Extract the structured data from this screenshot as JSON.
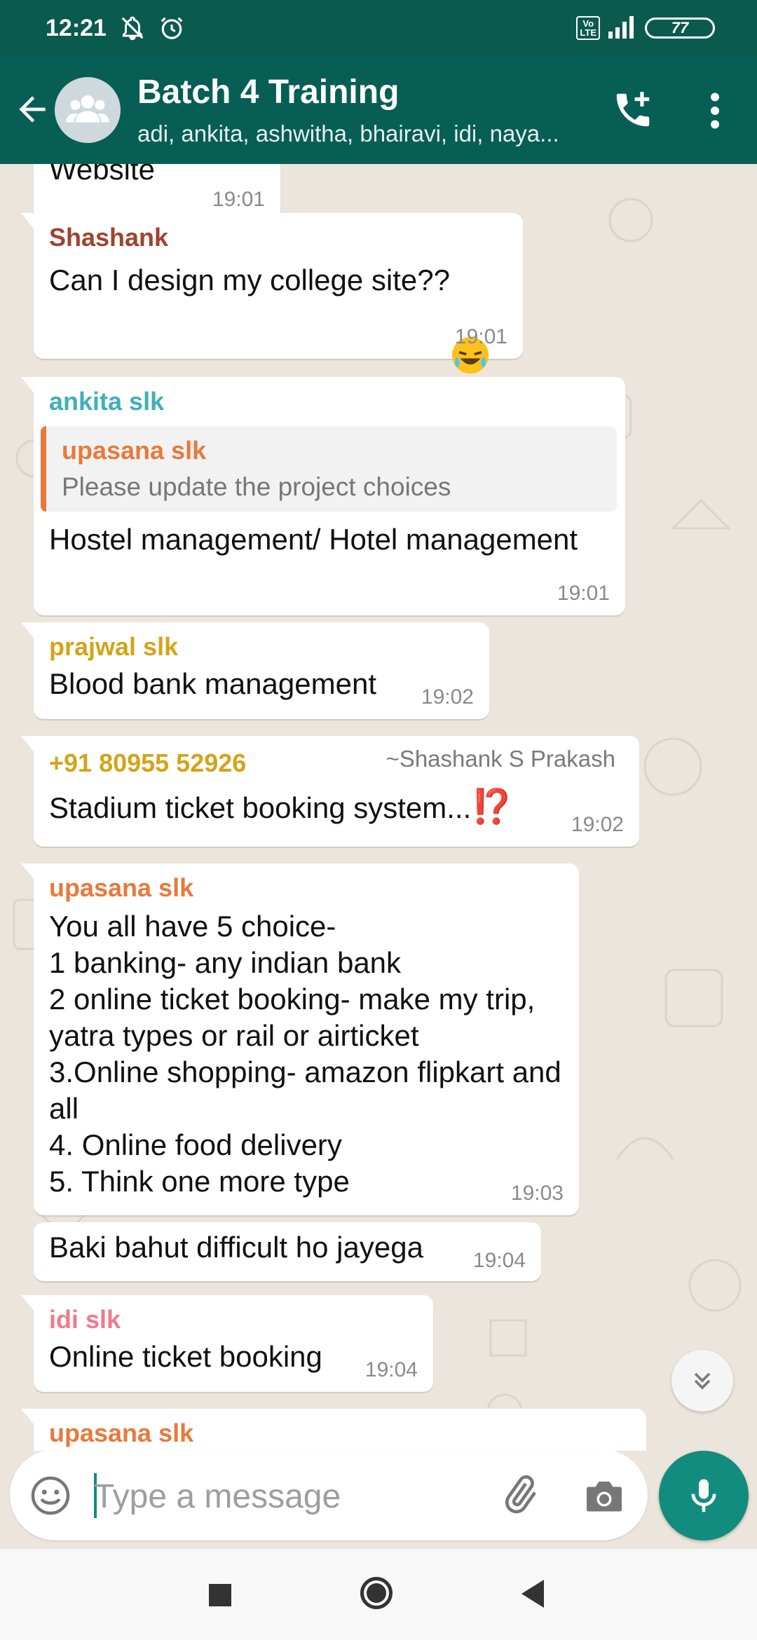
{
  "status_bar": {
    "time": "12:21",
    "volte": "Vo\nLTE",
    "battery": "77",
    "icons": [
      "mute-notifications-icon",
      "alarm-icon",
      "volte-icon",
      "signal-icon",
      "battery-icon"
    ]
  },
  "header": {
    "title": "Batch 4 Training",
    "subtitle": "adi, ankita, ashwitha, bhairavi, idi, naya...",
    "icons": [
      "back-arrow-icon",
      "group-avatar-icon",
      "add-call-icon",
      "more-options-icon"
    ]
  },
  "messages": [
    {
      "sender": "",
      "text": "Website",
      "time": "19:01"
    },
    {
      "sender": "Shashank",
      "sender_color": "#a0432f",
      "text": "Can I design my college site??",
      "emoji": "rolling-on-floor-laughing",
      "time": "19:01"
    },
    {
      "sender": "ankita slk",
      "sender_color": "#3fb0b8",
      "quote": {
        "sender": "upasana slk",
        "text": "Please update the project choices"
      },
      "text": "Hostel management/ Hotel management",
      "time": "19:01"
    },
    {
      "sender": "prajwal slk",
      "sender_color": "#d4a419",
      "text": "Blood bank management",
      "time": "19:02"
    },
    {
      "sender": "+91 80955 52926",
      "sender_color": "#d4a419",
      "aside_name": "~Shashank S Prakash",
      "text": "Stadium ticket booking system...",
      "emoji": "⁉️",
      "time": "19:02"
    },
    {
      "sender": "upasana slk",
      "sender_color": "#e8793c",
      "text": "You all have 5 choice-\n1 banking- any indian bank\n2 online ticket booking- make my trip, yatra types or rail or airticket\n3.Online shopping- amazon flipkart and all\n4. Online food delivery\n5. Think one more type",
      "time": "19:03"
    },
    {
      "sender": "",
      "text": "Baki bahut difficult ho jayega",
      "time": "19:04"
    },
    {
      "sender": "idi slk",
      "sender_color": "#f07a8c",
      "text": "Online ticket booking",
      "time": "19:04"
    },
    {
      "sender": "upasana slk",
      "sender_color": "#e8793c",
      "text": "",
      "time": ""
    }
  ],
  "composer": {
    "placeholder": "Type a message",
    "value": "",
    "icons": [
      "emoji-icon",
      "attach-icon",
      "camera-icon",
      "microphone-icon"
    ]
  },
  "scroll_button": {
    "icon": "scroll-down-icon"
  },
  "nav_bar": {
    "icons": [
      "recent-apps-icon",
      "home-icon",
      "back-icon"
    ]
  },
  "colors": {
    "status_bar": "#0a5a4e",
    "header": "#075e54",
    "accent": "#128c7e",
    "chat_background": "#ece5dd"
  }
}
